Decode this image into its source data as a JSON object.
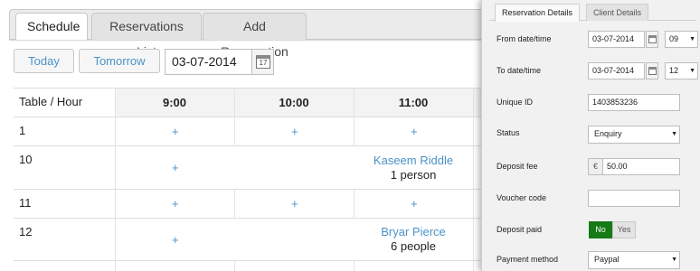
{
  "tabs": [
    {
      "label": "Schedule",
      "active": true
    },
    {
      "label": "Reservations List",
      "active": false
    },
    {
      "label": "Add Reservation",
      "active": false
    }
  ],
  "toolbar": {
    "today_label": "Today",
    "tomorrow_label": "Tomorrow",
    "date_value": "03-07-2014",
    "calendar_icon": "calendar-icon"
  },
  "grid": {
    "corner_label": "Table / Hour",
    "hours": [
      "9:00",
      "10:00",
      "11:00"
    ],
    "plus_symbol": "+",
    "rows": [
      {
        "table": "1"
      },
      {
        "table": "10"
      },
      {
        "table": "11"
      },
      {
        "table": "12"
      }
    ],
    "reservations": [
      {
        "name": "Kaseem Riddle",
        "size": "1 person"
      },
      {
        "name": "Bryar Pierce",
        "size": "6 people"
      }
    ]
  },
  "side_panel": {
    "tabs": [
      {
        "label": "Reservation Details",
        "active": true
      },
      {
        "label": "Client Details",
        "active": false
      }
    ],
    "from_label": "From date/time",
    "from_date": "03-07-2014",
    "from_hour": "09",
    "to_label": "To date/time",
    "to_date": "03-07-2014",
    "to_hour": "12",
    "unique_id_label": "Unique ID",
    "unique_id": "1403853236",
    "status_label": "Status",
    "status_value": "Enquiry",
    "deposit_fee_label": "Deposit fee",
    "currency_symbol": "€",
    "deposit_fee": "50.00",
    "voucher_label": "Voucher code",
    "voucher_value": "",
    "deposit_paid_label": "Deposit paid",
    "deposit_paid_no": "No",
    "deposit_paid_yes": "Yes",
    "deposit_paid_value": "No",
    "payment_method_label": "Payment method",
    "payment_method_value": "Paypal"
  },
  "colors": {
    "link_blue": "#4a92c8",
    "toggle_active_green": "#167a16"
  }
}
